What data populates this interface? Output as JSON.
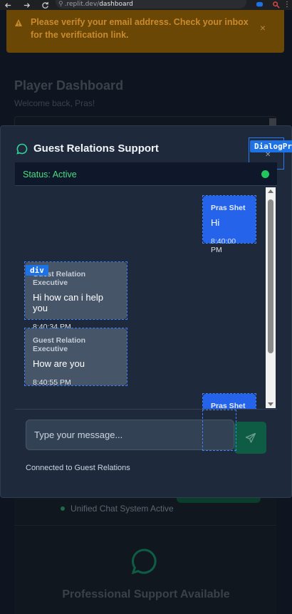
{
  "browser": {
    "url_prefix": ".replit.dev/",
    "url_path": "dashboard"
  },
  "banner": {
    "text": "Please verify your email address. Check your inbox for the verification link.",
    "close": "×"
  },
  "background_page": {
    "title": "Player Dashboard",
    "subtitle": "Welcome back, Pras!",
    "system_status": "Unified Chat System Active",
    "support_heading": "Professional Support Available"
  },
  "dialog": {
    "title": "Guest Relations Support",
    "debug_label": "DialogPr",
    "status": "Status: Active",
    "placeholder": "Type your message...",
    "connected_text": "Connected to Guest Relations"
  },
  "messages": [
    {
      "sender": "Pras Shet",
      "text": "Hi",
      "time": "8:40:00 PM",
      "role": "user"
    },
    {
      "sender": "Guest Relation Executive",
      "text": "Hi how can i help you",
      "time": "8:40:34 PM",
      "role": "agent"
    },
    {
      "sender": "Guest Relation Executive",
      "text": "How are you",
      "time": "8:40:55 PM",
      "role": "agent"
    },
    {
      "sender": "Pras Shet",
      "text": "",
      "time": "",
      "role": "user"
    }
  ],
  "overlay": {
    "div_tag": "div"
  },
  "colors": {
    "accent_green": "#4ade80",
    "user_bubble": "#2563eb",
    "agent_bubble": "#475569",
    "warning_bg": "#6b4705"
  }
}
